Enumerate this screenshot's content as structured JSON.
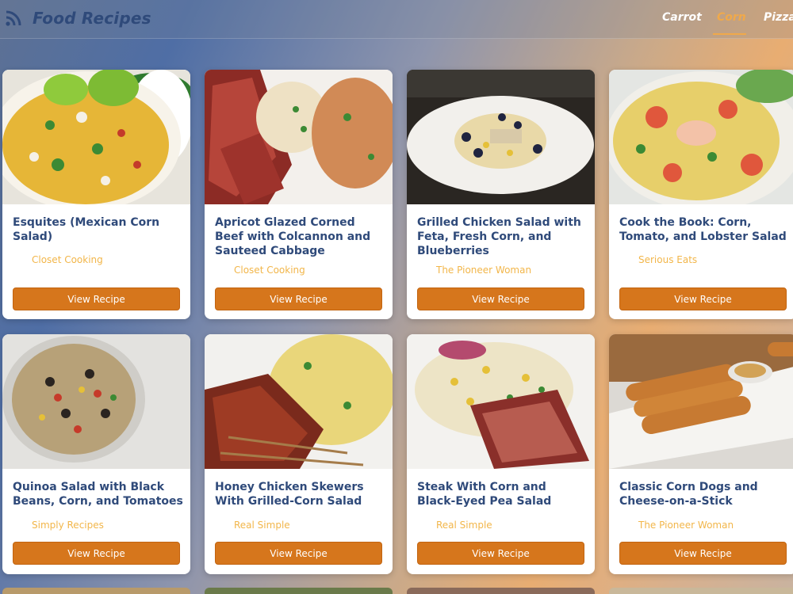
{
  "header": {
    "title": "Food Recipes",
    "logo_icon": "rss-feed-icon",
    "nav": [
      {
        "label": "Carrot",
        "active": false
      },
      {
        "label": "Corn",
        "active": true
      },
      {
        "label": "Pizza",
        "active": false
      }
    ]
  },
  "colors": {
    "accent": "#f0a94a",
    "title": "#2f4a7a",
    "button": "#d6761c",
    "source": "#f2b64a"
  },
  "recipes": [
    {
      "title": "Esquites (Mexican Corn Salad)",
      "source": "Closet Cooking",
      "button": "View Recipe"
    },
    {
      "title": "Apricot Glazed Corned Beef with Colcannon and Sauteed Cabbage",
      "source": "Closet Cooking",
      "button": "View Recipe"
    },
    {
      "title": "Grilled Chicken Salad with Feta, Fresh Corn, and Blueberries",
      "source": "The Pioneer Woman",
      "button": "View Recipe"
    },
    {
      "title": "Cook the Book: Corn, Tomato, and Lobster Salad",
      "source": "Serious Eats",
      "button": "View Recipe"
    },
    {
      "title": "Quinoa Salad with Black Beans, Corn, and Tomatoes",
      "source": "Simply Recipes",
      "button": "View Recipe"
    },
    {
      "title": "Honey Chicken Skewers With Grilled-Corn Salad",
      "source": "Real Simple",
      "button": "View Recipe"
    },
    {
      "title": "Steak With Corn and Black-Eyed Pea Salad",
      "source": "Real Simple",
      "button": "View Recipe"
    },
    {
      "title": "Classic Corn Dogs and Cheese-on-a-Stick",
      "source": "The Pioneer Woman",
      "button": "View Recipe"
    }
  ]
}
